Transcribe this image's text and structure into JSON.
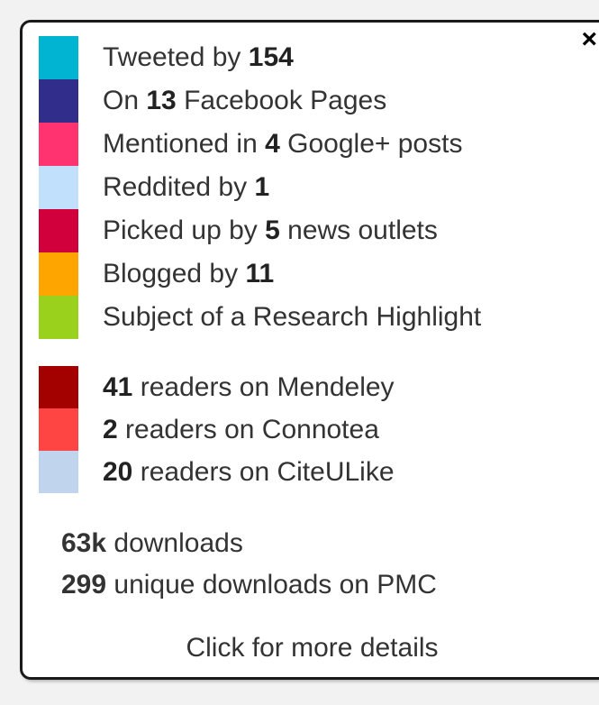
{
  "close_glyph": "×",
  "sources": [
    {
      "color": "#00b4d2",
      "pre": "Tweeted by ",
      "count": "154",
      "post": ""
    },
    {
      "color": "#302e8a",
      "pre": "On ",
      "count": "13",
      "post": " Facebook Pages"
    },
    {
      "color": "#ff3370",
      "pre": "Mentioned in ",
      "count": "4",
      "post": " Google+ posts"
    },
    {
      "color": "#c0e0fc",
      "pre": "Reddited by ",
      "count": "1",
      "post": ""
    },
    {
      "color": "#d1003c",
      "pre": "Picked up by ",
      "count": "5",
      "post": " news outlets"
    },
    {
      "color": "#ffa500",
      "pre": "Blogged by ",
      "count": "11",
      "post": ""
    },
    {
      "color": "#9ad11c",
      "pre": "Subject of a Research Highlight",
      "count": "",
      "post": ""
    }
  ],
  "readers": [
    {
      "color": "#a30000",
      "count": "41",
      "post": " readers on Mendeley"
    },
    {
      "color": "#ff4444",
      "count": "2",
      "post": " readers on Connotea"
    },
    {
      "color": "#c0d4ee",
      "count": "20",
      "post": " readers on CiteULike"
    }
  ],
  "downloads": [
    {
      "count": "63k",
      "post": " downloads"
    },
    {
      "count": "299",
      "post": " unique downloads on PMC"
    }
  ],
  "more_link": "Click for more details"
}
